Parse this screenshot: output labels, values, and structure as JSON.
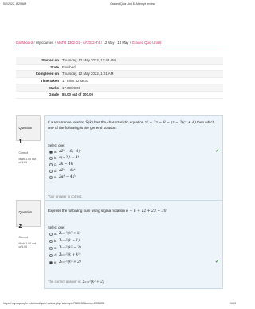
{
  "print_header": {
    "date": "5/2/2022, 8:29 AM",
    "title": "Graded Quiz Unit 6: Attempt review"
  },
  "breadcrumb": {
    "dashboard": "Dashboard",
    "my_courses": "My courses",
    "course": "MATH 1302-01 - AY2022-T4",
    "week": "12 May - 18 May",
    "quiz": "Graded Quiz Unit 6"
  },
  "summary": [
    {
      "label": "Started on",
      "value": "Thursday, 12 May 2022, 12:43 AM"
    },
    {
      "label": "State",
      "value": "Finished"
    },
    {
      "label": "Completed on",
      "value": "Thursday, 12 May 2022, 1:01 AM"
    },
    {
      "label": "Time taken",
      "value": "17 mins 42 secs"
    },
    {
      "label": "Marks",
      "value": "17.00/20.00"
    },
    {
      "label": "Grade",
      "value": "85.00 out of 100.00"
    }
  ],
  "questions": [
    {
      "label": "Question",
      "number": "1",
      "status": "Correct",
      "mark": "Mark 1.00 out of 1.00",
      "text_pre": "If a recurrence relation",
      "text_math1": "S(k)",
      "text_mid": "has the characteristic equation",
      "text_math2": "z³ + 2z − 8 − (z − 2)(z + 4)",
      "text_post": "then which one of the following is the general solution.",
      "select_one": "Select one:",
      "options": [
        {
          "letter": "a.",
          "text": "a2ᵏ − 6(−4)ᵏ"
        },
        {
          "letter": "b.",
          "text": "α(−2)ᵏ + 4ᵏ"
        },
        {
          "letter": "c.",
          "text": "2k − 4k"
        },
        {
          "letter": "d.",
          "text": "a2ᵏ − 4kᵏ"
        },
        {
          "letter": "e.",
          "text": "2αᵏ − 4kᵏ"
        }
      ],
      "feedback": "Your answer is correct.",
      "correct_prefix": "The correct answer is:",
      "correct_answer": "a2ᵏ + b(−4)ᵏ"
    },
    {
      "label": "Question",
      "number": "2",
      "status": "Correct",
      "mark": "Mark 1.00 out of 1.00",
      "text_pre": "Express the following sum using sigma notation",
      "text_math1": "6 − 6 + 12 + 23 + 30",
      "text_mid": "",
      "text_math2": "",
      "text_post": "",
      "select_one": "Select one:",
      "options": [
        {
          "letter": "a.",
          "text": "Σₖ₌₁⁵(k² + k)"
        },
        {
          "letter": "b.",
          "text": "Σₖ₌₁⁵(k − 1)"
        },
        {
          "letter": "c.",
          "text": "Σₖ₌₁⁵(k² − 3)"
        },
        {
          "letter": "d.",
          "text": "Σₖ₌₁⁵(k + k²)"
        },
        {
          "letter": "e.",
          "text": "Σₖ₌₁⁵(k² + 2)"
        }
      ],
      "feedback": "",
      "correct_prefix": "The correct answer is:",
      "correct_answer": "Σₖ₌₁⁵(k² + 2)"
    }
  ],
  "print_footer": {
    "url": "https://my.uopeople.edu/mod/quiz/review.php?attempt=7080151&cmid=293605",
    "page": "1/13"
  },
  "colors": {
    "link": "#c8336b",
    "panel": "#eef5fa",
    "check": "#3a9f3a"
  }
}
